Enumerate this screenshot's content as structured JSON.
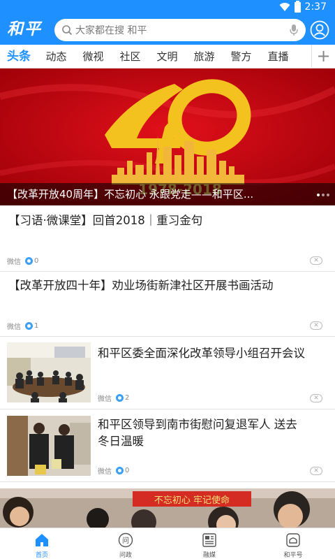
{
  "status": {
    "time": "2:37"
  },
  "header": {
    "logo_text": "和平",
    "search_placeholder": "大家都在搜 和平"
  },
  "tabs": [
    "头条",
    "动态",
    "微视",
    "社区",
    "文明",
    "旅游",
    "警方",
    "直播"
  ],
  "tab_add": "+",
  "banner": {
    "big_text": "40",
    "years": "1978-2018",
    "caption": "【改革开放40周年】不忘初心 永跟党走——和平区..."
  },
  "feed": [
    {
      "title": "【习语·微课堂】回首2018｜重习金句",
      "source": "微信",
      "views": "0"
    },
    {
      "title": "【改革开放四十年】劝业场街新津社区开展书画活动",
      "source": "微信",
      "views": "1"
    },
    {
      "title": "和平区委全面深化改革领导小组召开会议",
      "source": "微信",
      "views": "2"
    },
    {
      "title_line1": "和平区领导到南市街慰问复退军人 送去",
      "title_line2": "冬日温暖",
      "source": "微信",
      "views": "0"
    }
  ],
  "bottom_banner": {
    "slogan": "不忘初心 牢记使命"
  },
  "nav": [
    {
      "label": "首页",
      "icon": "home-icon",
      "active": true
    },
    {
      "label": "问政",
      "icon": "question-icon",
      "active": false
    },
    {
      "label": "融媒",
      "icon": "media-icon",
      "active": false
    },
    {
      "label": "和平号",
      "icon": "account-icon",
      "active": false
    }
  ],
  "colors": {
    "brand": "#1e90ff",
    "banner_red": "#c4000d",
    "gold": "#f4c21f"
  }
}
